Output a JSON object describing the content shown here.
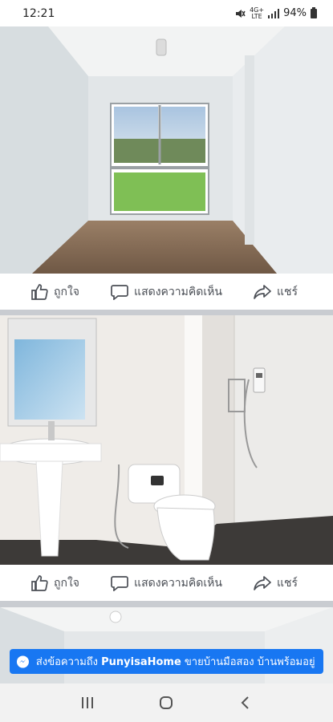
{
  "status_bar": {
    "time": "12:21",
    "network": "4G+",
    "network_sub": "LTE",
    "battery": "94%",
    "icons": [
      "mute-icon",
      "signal-icon",
      "battery-icon"
    ]
  },
  "posts": [
    {
      "actions": {
        "like": "ถูกใจ",
        "comment": "แสดงความคิดเห็น",
        "share": "แชร์"
      }
    },
    {
      "actions": {
        "like": "ถูกใจ",
        "comment": "แสดงความคิดเห็น",
        "share": "แชร์"
      }
    }
  ],
  "messenger": {
    "prefix": "ส่งข้อความถึง",
    "page_name": "PunyisaHome",
    "suffix": "ขายบ้านมือสอง บ้านพร้อมอยู่ บ้...",
    "icon": "messenger-icon",
    "color": "#1877f2"
  },
  "nav": {
    "icons": [
      "recent-apps-icon",
      "home-icon",
      "back-icon"
    ]
  }
}
